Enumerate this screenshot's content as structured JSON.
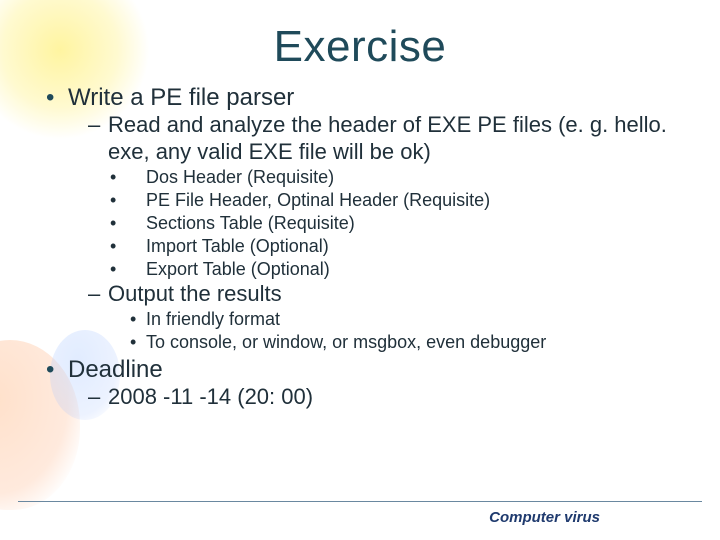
{
  "title": "Exercise",
  "bullets": {
    "b1": "Write a PE file parser",
    "b1_1": "Read and analyze the header of EXE PE files (e. g. hello. exe, any valid EXE file will be ok)",
    "b1_1_items": {
      "i1": "Dos Header (Requisite)",
      "i2": "PE File Header, Optinal Header (Requisite)",
      "i3": "Sections Table (Requisite)",
      "i4": "Import Table (Optional)",
      "i5": "Export Table (Optional)"
    },
    "b1_2": "Output the results",
    "b1_2_items": {
      "i1": "In friendly format",
      "i2": "To console, or window, or msgbox, even debugger"
    },
    "b2": "Deadline",
    "b2_1": "2008 -11 -14 (20: 00)"
  },
  "footer": "Computer virus"
}
